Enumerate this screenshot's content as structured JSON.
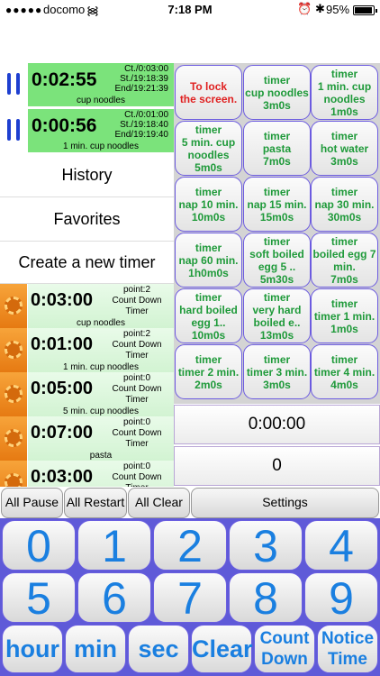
{
  "status": {
    "carrier": "docomo",
    "time": "7:18 PM",
    "battery": "95%"
  },
  "running": [
    {
      "time": "0:02:55",
      "ct": "Ct./0:03:00",
      "st": "St./19:18:39",
      "end": "End/19:21:39",
      "name": "cup noodles"
    },
    {
      "time": "0:00:56",
      "ct": "Ct./0:01:00",
      "st": "St./19:18:40",
      "end": "End/19:19:40",
      "name": "1 min. cup noodles"
    }
  ],
  "menu": {
    "history": "History",
    "favorites": "Favorites",
    "create": "Create a new timer"
  },
  "saved": [
    {
      "time": "0:03:00",
      "point": "point:2",
      "mode": "Count Down",
      "kind": "Timer",
      "name": "cup noodles"
    },
    {
      "time": "0:01:00",
      "point": "point:2",
      "mode": "Count Down",
      "kind": "Timer",
      "name": "1 min. cup noodles"
    },
    {
      "time": "0:05:00",
      "point": "point:0",
      "mode": "Count Down",
      "kind": "Timer",
      "name": "5 min. cup noodles"
    },
    {
      "time": "0:07:00",
      "point": "point:0",
      "mode": "Count Down",
      "kind": "Timer",
      "name": "pasta"
    },
    {
      "time": "0:03:00",
      "point": "point:0",
      "mode": "Count Down",
      "kind": "Timer",
      "name": ""
    }
  ],
  "presets": [
    {
      "l1": "To lock",
      "l2": "the screen.",
      "l3": ""
    },
    {
      "l1": "timer",
      "l2": "cup noodles",
      "l3": "3m0s"
    },
    {
      "l1": "timer",
      "l2": "1 min. cup noodles",
      "l3": "1m0s"
    },
    {
      "l1": "timer",
      "l2": "5 min. cup noodles",
      "l3": "5m0s"
    },
    {
      "l1": "timer",
      "l2": "pasta",
      "l3": "7m0s"
    },
    {
      "l1": "timer",
      "l2": "hot water",
      "l3": "3m0s"
    },
    {
      "l1": "timer",
      "l2": "nap 10 min.",
      "l3": "10m0s"
    },
    {
      "l1": "timer",
      "l2": "nap 15 min.",
      "l3": "15m0s"
    },
    {
      "l1": "timer",
      "l2": "nap 30 min.",
      "l3": "30m0s"
    },
    {
      "l1": "timer",
      "l2": "nap 60 min.",
      "l3": "1h0m0s"
    },
    {
      "l1": "timer",
      "l2": "soft boiled egg 5 ..",
      "l3": "5m30s"
    },
    {
      "l1": "timer",
      "l2": "boiled egg 7 min.",
      "l3": "7m0s"
    },
    {
      "l1": "timer",
      "l2": "hard boiled egg 1..",
      "l3": "10m0s"
    },
    {
      "l1": "timer",
      "l2": "very hard boiled e..",
      "l3": "13m0s"
    },
    {
      "l1": "timer",
      "l2": "timer 1 min.",
      "l3": "1m0s"
    },
    {
      "l1": "timer",
      "l2": "timer 2 min.",
      "l3": "2m0s"
    },
    {
      "l1": "timer",
      "l2": "timer 3 min.",
      "l3": "3m0s"
    },
    {
      "l1": "timer",
      "l2": "timer 4 min.",
      "l3": "4m0s"
    }
  ],
  "display": {
    "time": "0:00:00",
    "value": "0"
  },
  "controls": {
    "all_pause": "All Pause",
    "all_restart": "All Restart",
    "all_clear": "All Clear",
    "settings": "Settings"
  },
  "keypad": {
    "digits": [
      "0",
      "1",
      "2",
      "3",
      "4",
      "5",
      "6",
      "7",
      "8",
      "9"
    ],
    "hour": "hour",
    "min": "min",
    "sec": "sec",
    "clear": "Clear",
    "count_down_1": "Count",
    "count_down_2": "Down",
    "notice_1": "Notice",
    "notice_2": "Time"
  },
  "colors": {
    "running_bg": "#7be37b",
    "preset_text": "#1f9a3a",
    "lock_text": "#e02020",
    "key_text": "#1a7fe0",
    "keypad_bg": "#5f5ad8"
  }
}
